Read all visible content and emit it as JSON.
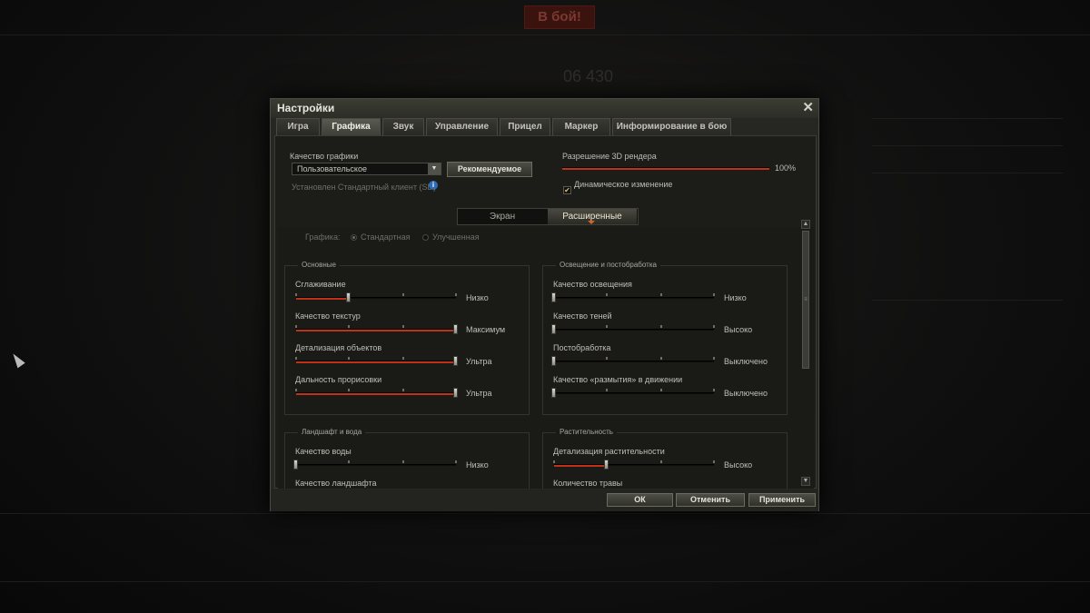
{
  "window": {
    "title": "Настройки",
    "close_label": "✕"
  },
  "tabs": [
    "Игра",
    "Графика",
    "Звук",
    "Управление",
    "Прицел",
    "Маркер",
    "Информирование в бою"
  ],
  "active_tab": "Графика",
  "graphics": {
    "quality_label": "Качество графики",
    "quality_value": "Пользовательское",
    "recommended_button": "Рекомендуемое",
    "client_note": "Установлен Стандартный клиент (SD)",
    "info_icon_text": "i",
    "render_res_label": "Разрешение 3D рендера",
    "render_res_value": "100%",
    "render_res_percent": 100,
    "dynamic_change_label": "Динамическое изменение",
    "dynamic_change_checked": true,
    "check_mark": "✔"
  },
  "subtabs": [
    "Экран",
    "Расширенные"
  ],
  "active_subtab": "Расширенные",
  "graphics_mode": {
    "label": "Графика:",
    "options": [
      "Стандартная",
      "Улучшенная"
    ],
    "selected": "Стандартная"
  },
  "groups": {
    "basic": {
      "title": "Основные",
      "sliders": [
        {
          "label": "Сглаживание",
          "value": "Низко",
          "level": 0.33
        },
        {
          "label": "Качество текстур",
          "value": "Максимум",
          "level": 1.0
        },
        {
          "label": "Детализация объектов",
          "value": "Ультра",
          "level": 1.0
        },
        {
          "label": "Дальность прорисовки",
          "value": "Ультра",
          "level": 1.0
        }
      ]
    },
    "lighting": {
      "title": "Освещение и постобработка",
      "sliders": [
        {
          "label": "Качество освещения",
          "value": "Низко",
          "level": 0.0
        },
        {
          "label": "Качество теней",
          "value": "Высоко",
          "level": 0.0
        },
        {
          "label": "Постобработка",
          "value": "Выключено",
          "level": 0.0
        },
        {
          "label": "Качество «размытия» в движении",
          "value": "Выключено",
          "level": 0.0
        }
      ]
    },
    "landscape": {
      "title": "Ландшафт и вода",
      "sliders": [
        {
          "label": "Качество воды",
          "value": "Низко",
          "level": 0.0
        },
        {
          "label": "Качество ландшафта",
          "value": "",
          "level": 0.0
        }
      ]
    },
    "vegetation": {
      "title": "Растительность",
      "sliders": [
        {
          "label": "Детализация растительности",
          "value": "Высоко",
          "level": 0.33
        },
        {
          "label": "Количество травы",
          "value": "",
          "level": 0.0
        }
      ]
    }
  },
  "scroll": {
    "up": "▲",
    "down": "▼",
    "thumb": "≡"
  },
  "buttons": {
    "ok": "ОК",
    "cancel": "Отменить",
    "apply": "Применить"
  },
  "background": {
    "rating": "06 430",
    "battle": "В бой!"
  },
  "colors": {
    "accent_red": "#c03218",
    "window_bg": "#262622"
  }
}
